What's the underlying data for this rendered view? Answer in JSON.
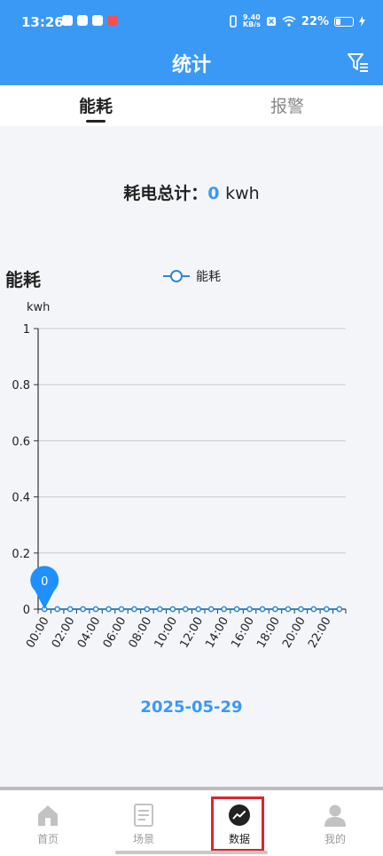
{
  "status": {
    "time": "13:26",
    "net_speed_value": "9.40",
    "net_speed_unit": "KB/s",
    "battery": "22%"
  },
  "header": {
    "title": "统计"
  },
  "tabs": [
    {
      "label": "能耗",
      "active": true
    },
    {
      "label": "报警",
      "active": false
    }
  ],
  "summary": {
    "label": "耗电总计：",
    "value": "0",
    "unit": "kwh"
  },
  "chart_data": {
    "type": "line",
    "title": "能耗",
    "ylabel": "kwh",
    "legend": {
      "position": "top-center",
      "entries": [
        "能耗"
      ]
    },
    "x_tick_labels": [
      "00:00",
      "02:00",
      "04:00",
      "06:00",
      "08:00",
      "10:00",
      "12:00",
      "14:00",
      "16:00",
      "18:00",
      "20:00",
      "22:00"
    ],
    "x": [
      "00:00",
      "01:00",
      "02:00",
      "03:00",
      "04:00",
      "05:00",
      "06:00",
      "07:00",
      "08:00",
      "09:00",
      "10:00",
      "11:00",
      "12:00",
      "13:00",
      "14:00",
      "15:00",
      "16:00",
      "17:00",
      "18:00",
      "19:00",
      "20:00",
      "21:00",
      "22:00",
      "23:00"
    ],
    "series": [
      {
        "name": "能耗",
        "color": "#2f86cf",
        "values": [
          0,
          0,
          0,
          0,
          0,
          0,
          0,
          0,
          0,
          0,
          0,
          0,
          0,
          0,
          0,
          0,
          0,
          0,
          0,
          0,
          0,
          0,
          0,
          0
        ]
      }
    ],
    "y_ticks": [
      "0",
      "0.2",
      "0.4",
      "0.6",
      "0.8",
      "1"
    ],
    "ylim": [
      0,
      1
    ],
    "grid": true,
    "marker": {
      "index": 0,
      "label": "0",
      "color": "#1e90ff"
    }
  },
  "date": "2025-05-29",
  "tabbar": [
    {
      "label": "首页",
      "icon": "home-icon"
    },
    {
      "label": "场景",
      "icon": "document-icon"
    },
    {
      "label": "数据",
      "icon": "chart-icon",
      "active": true
    },
    {
      "label": "我的",
      "icon": "user-icon"
    }
  ],
  "colors": {
    "primary": "#3a99f5",
    "highlight": "#e0232c"
  }
}
